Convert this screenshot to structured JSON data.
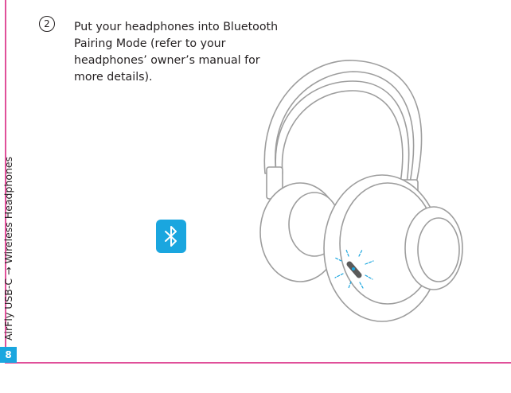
{
  "page": {
    "number": "8",
    "side_title": "AirFly USB-C → Wireless Headphones"
  },
  "step": {
    "number": "2",
    "instruction": "Put your headphones into Bluetooth Pairing Mode (refer to your headphones’ owner’s manual for more details)."
  },
  "icons": {
    "bluetooth": "bluetooth-icon",
    "headphones": "headphones-illustration"
  },
  "colors": {
    "accent_blue": "#1aa6df",
    "rule_pink": "#e0509a",
    "text": "#231f20",
    "line_art": "#9d9d9d"
  }
}
